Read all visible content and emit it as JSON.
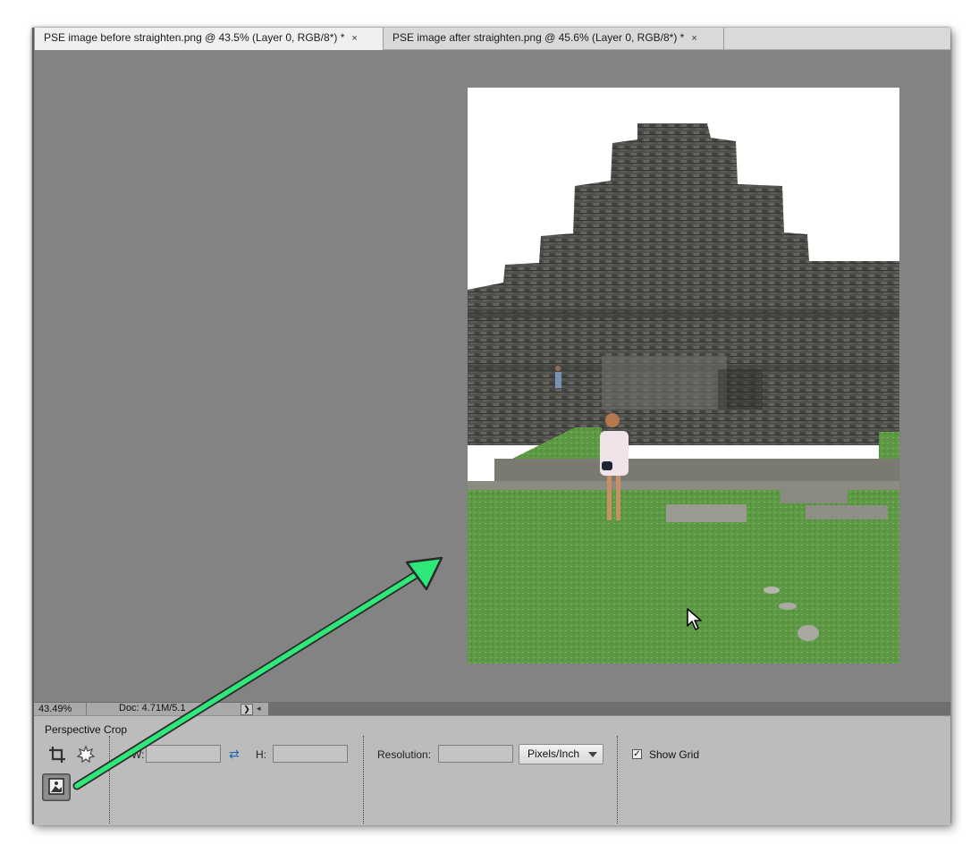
{
  "tabs": [
    {
      "label": "PSE image before straighten.png @ 43.5% (Layer 0, RGB/8*) *",
      "close": "×",
      "active": true
    },
    {
      "label": "PSE image after straighten.png @ 45.6% (Layer 0, RGB/8*) *",
      "close": "×",
      "active": false
    }
  ],
  "status": {
    "zoom": "43.49%",
    "doc": "Doc: 4.71M/5.1",
    "nav": "❯",
    "scroll_left": "◂"
  },
  "options": {
    "tool_name": "Perspective Crop",
    "tools": [
      {
        "name": "crop-tool-icon"
      },
      {
        "name": "cookie-cutter-icon"
      },
      {
        "name": "perspective-crop-icon"
      }
    ],
    "width_label": "W:",
    "width_value": "",
    "swap_icon": "⇄",
    "height_label": "H:",
    "height_value": "",
    "resolution_label": "Resolution:",
    "resolution_value": "",
    "units_value": "Pixels/Inch",
    "show_grid_checked": true,
    "show_grid_mark": "✓",
    "show_grid_label": "Show Grid"
  },
  "colors": {
    "workspace_bg": "#838383",
    "options_bg": "#bcbcbc",
    "annotation_arrow": "#2ee87a"
  }
}
